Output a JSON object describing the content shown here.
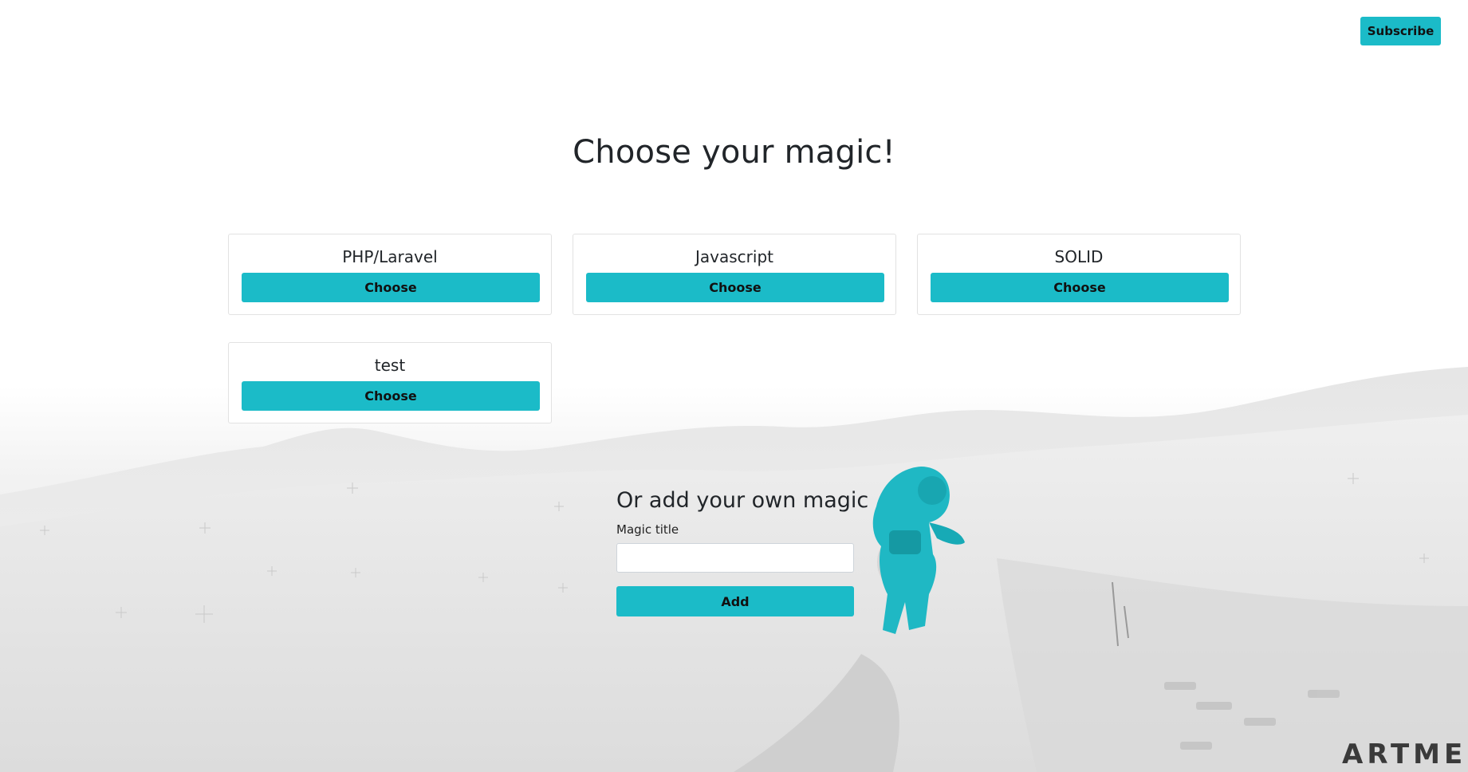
{
  "header": {
    "subscribe_label": "Subscribe"
  },
  "page": {
    "title": "Choose your magic!"
  },
  "magics": [
    {
      "title": "PHP/Laravel",
      "button": "Choose"
    },
    {
      "title": "Javascript",
      "button": "Choose"
    },
    {
      "title": "SOLID",
      "button": "Choose"
    },
    {
      "title": "test",
      "button": "Choose"
    }
  ],
  "add_form": {
    "title": "Or add your own magic",
    "label": "Magic title",
    "input_value": "",
    "button": "Add"
  },
  "brand": {
    "logo_text": "ARTME"
  },
  "colors": {
    "accent": "#1bbbc8",
    "text": "#212529",
    "astronaut": "#1fb8c4"
  },
  "icons": [
    "astronaut-illustration"
  ]
}
